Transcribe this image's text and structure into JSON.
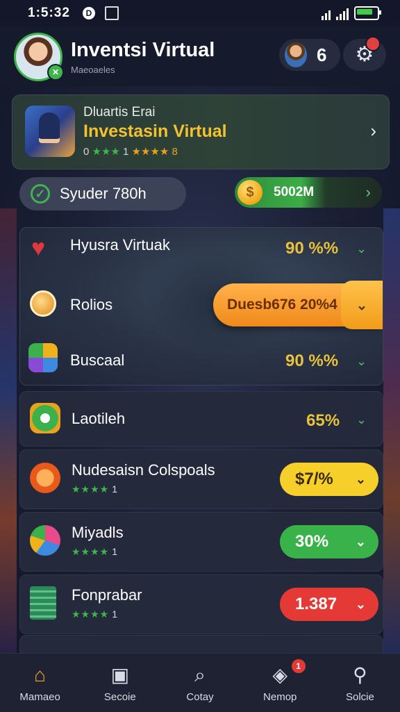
{
  "status_bar": {
    "time": "1:5:32",
    "notification_glyph": "D"
  },
  "header": {
    "title": "Inventsi Virtual",
    "subtitle": "Maeoaeles",
    "coin_count": "6",
    "avatar_badge": "✕"
  },
  "featured": {
    "small_text": "Dluartis Erai",
    "title": "Investasin Virtual",
    "rating_prefix": "0",
    "rating_mid": "1",
    "rating_suffix": "8"
  },
  "status": {
    "text": "Syuder 780h"
  },
  "balance": {
    "coin_symbol": "$",
    "amount": "5002M"
  },
  "group_rows": [
    {
      "label": "Hyusra Virtuak",
      "value": "90 %%"
    },
    {
      "label": "Rolios",
      "value": "Duesb676 20%4"
    },
    {
      "label": "Buscaal",
      "value": "90 %%"
    }
  ],
  "rows": [
    {
      "title": "Laotileh",
      "value": "65%",
      "color": "#e8c23a"
    },
    {
      "title": "Nudesaisn Colspoals",
      "stars": "1",
      "value": "$7/%",
      "color": "#f7cf2b"
    },
    {
      "title": "Miyadls",
      "stars": "1",
      "value": "30%",
      "color": "#39b249"
    },
    {
      "title": "Fonprabar",
      "stars": "1",
      "value": "1.387",
      "color": "#e53935"
    }
  ],
  "nav": [
    {
      "label": "Mamaeo",
      "icon": "home-icon",
      "active": true
    },
    {
      "label": "Secoie",
      "icon": "calendar-icon"
    },
    {
      "label": "Cotay",
      "icon": "chart-icon"
    },
    {
      "label": "Nemop",
      "icon": "bag-icon",
      "badge": "1"
    },
    {
      "label": "Solcie",
      "icon": "search-icon"
    }
  ]
}
